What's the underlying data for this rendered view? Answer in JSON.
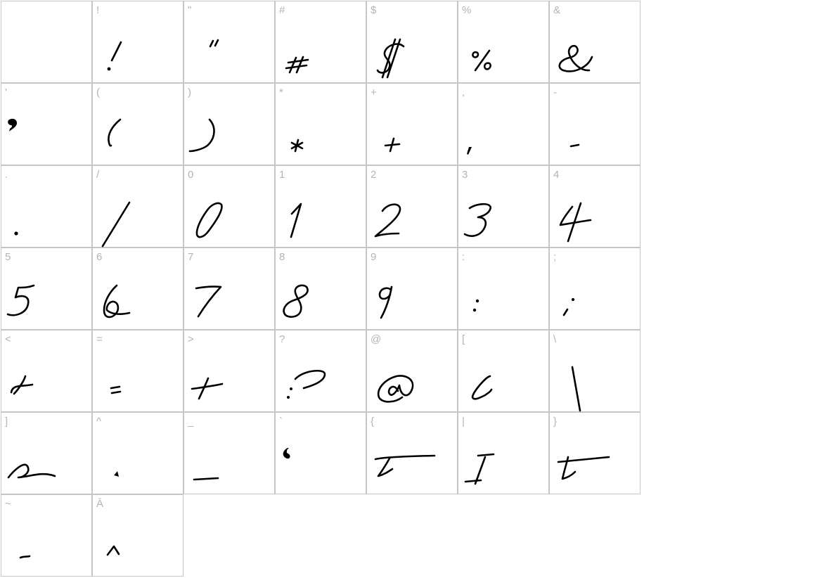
{
  "glyph_chart": {
    "columns": 7,
    "cells": [
      {
        "char": "",
        "glyph": "space"
      },
      {
        "char": "!",
        "glyph": "exclamation"
      },
      {
        "char": "\"",
        "glyph": "double-quote"
      },
      {
        "char": "#",
        "glyph": "hash"
      },
      {
        "char": "$",
        "glyph": "dollar"
      },
      {
        "char": "%",
        "glyph": "percent"
      },
      {
        "char": "&",
        "glyph": "ampersand"
      },
      {
        "char": "'",
        "glyph": "apostrophe"
      },
      {
        "char": "(",
        "glyph": "paren-left"
      },
      {
        "char": ")",
        "glyph": "paren-right"
      },
      {
        "char": "*",
        "glyph": "asterisk"
      },
      {
        "char": "+",
        "glyph": "plus"
      },
      {
        "char": ",",
        "glyph": "comma"
      },
      {
        "char": "-",
        "glyph": "hyphen"
      },
      {
        "char": ".",
        "glyph": "period"
      },
      {
        "char": "/",
        "glyph": "slash"
      },
      {
        "char": "0",
        "glyph": "digit-0"
      },
      {
        "char": "1",
        "glyph": "digit-1"
      },
      {
        "char": "2",
        "glyph": "digit-2"
      },
      {
        "char": "3",
        "glyph": "digit-3"
      },
      {
        "char": "4",
        "glyph": "digit-4"
      },
      {
        "char": "5",
        "glyph": "digit-5"
      },
      {
        "char": "6",
        "glyph": "digit-6"
      },
      {
        "char": "7",
        "glyph": "digit-7"
      },
      {
        "char": "8",
        "glyph": "digit-8"
      },
      {
        "char": "9",
        "glyph": "digit-9"
      },
      {
        "char": ":",
        "glyph": "colon"
      },
      {
        "char": ";",
        "glyph": "semicolon"
      },
      {
        "char": "<",
        "glyph": "less-than"
      },
      {
        "char": "=",
        "glyph": "equals"
      },
      {
        "char": ">",
        "glyph": "greater-than"
      },
      {
        "char": "?",
        "glyph": "question"
      },
      {
        "char": "@",
        "glyph": "at"
      },
      {
        "char": "[",
        "glyph": "bracket-left"
      },
      {
        "char": "\\",
        "glyph": "backslash"
      },
      {
        "char": "]",
        "glyph": "bracket-right"
      },
      {
        "char": "^",
        "glyph": "caret"
      },
      {
        "char": "_",
        "glyph": "underscore"
      },
      {
        "char": "`",
        "glyph": "grave"
      },
      {
        "char": "{",
        "glyph": "brace-left"
      },
      {
        "char": "|",
        "glyph": "bar"
      },
      {
        "char": "}",
        "glyph": "brace-right"
      },
      {
        "char": "~",
        "glyph": "tilde"
      },
      {
        "char": "Ā",
        "glyph": "a-macron"
      }
    ]
  }
}
